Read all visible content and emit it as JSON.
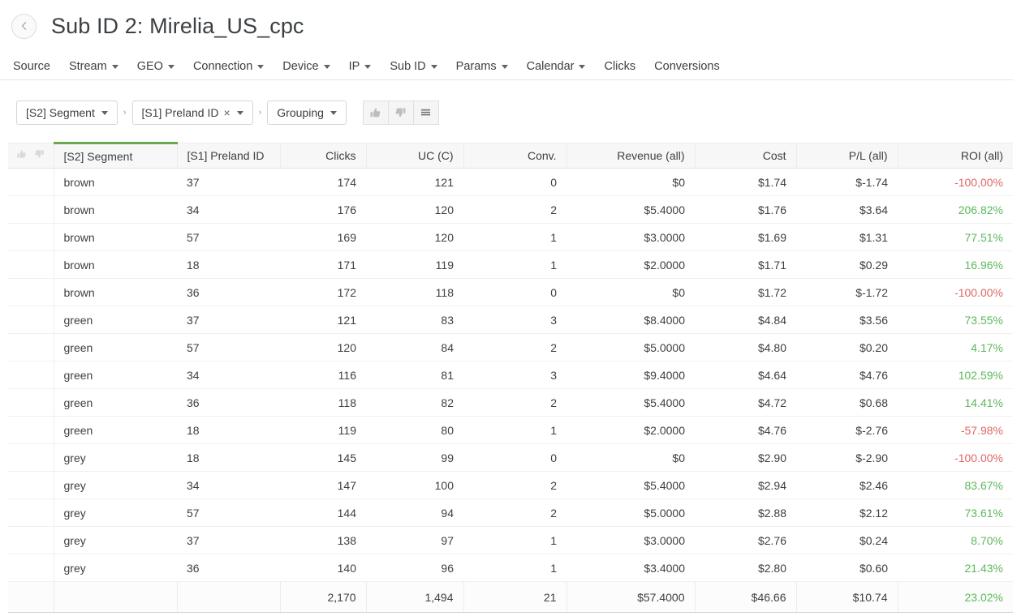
{
  "header": {
    "back_icon": "chevron-left-icon",
    "title": "Sub ID 2: Mirelia_US_cpc"
  },
  "nav": {
    "items": [
      {
        "label": "Source",
        "has_caret": false
      },
      {
        "label": "Stream",
        "has_caret": true
      },
      {
        "label": "GEO",
        "has_caret": true
      },
      {
        "label": "Connection",
        "has_caret": true
      },
      {
        "label": "Device",
        "has_caret": true
      },
      {
        "label": "IP",
        "has_caret": true
      },
      {
        "label": "Sub ID",
        "has_caret": true
      },
      {
        "label": "Params",
        "has_caret": true
      },
      {
        "label": "Calendar",
        "has_caret": true
      },
      {
        "label": "Clicks",
        "has_caret": false
      },
      {
        "label": "Conversions",
        "has_caret": false
      }
    ]
  },
  "toolbar": {
    "chips": [
      {
        "label": "[S2] Segment",
        "removable": false
      },
      {
        "label": "[S1] Preland ID",
        "removable": true
      },
      {
        "label": "Grouping",
        "removable": false
      }
    ],
    "separator": "›",
    "buttons": [
      {
        "icon": "thumbs-up-icon",
        "name": "vote-up-button"
      },
      {
        "icon": "thumbs-down-icon",
        "name": "vote-down-button"
      },
      {
        "icon": "hamburger-menu-icon",
        "name": "table-menu-button"
      }
    ]
  },
  "table": {
    "vote_icons": {
      "up": "thumbs-up-icon",
      "down": "thumbs-down-icon"
    },
    "sorted_column_index": 0,
    "sort_accent_color": "#6aa84f",
    "positive_color": "#5cb85c",
    "negative_color": "#e06666",
    "columns": [
      {
        "label": "[S2] Segment",
        "align": "left"
      },
      {
        "label": "[S1] Preland ID",
        "align": "left"
      },
      {
        "label": "Clicks",
        "align": "right"
      },
      {
        "label": "UC (C)",
        "align": "right"
      },
      {
        "label": "Conv.",
        "align": "right"
      },
      {
        "label": "Revenue (all)",
        "align": "right"
      },
      {
        "label": "Cost",
        "align": "right"
      },
      {
        "label": "P/L (all)",
        "align": "right"
      },
      {
        "label": "ROI (all)",
        "align": "right"
      }
    ],
    "rows": [
      {
        "segment": "brown",
        "preland_id": "37",
        "clicks": "174",
        "uc": "121",
        "conv": "0",
        "revenue": "$0",
        "cost": "$1.74",
        "pl": "$-1.74",
        "roi": "-100,00%",
        "roi_sign": "neg"
      },
      {
        "segment": "brown",
        "preland_id": "34",
        "clicks": "176",
        "uc": "120",
        "conv": "2",
        "revenue": "$5.4000",
        "cost": "$1.76",
        "pl": "$3.64",
        "roi": "206.82%",
        "roi_sign": "pos"
      },
      {
        "segment": "brown",
        "preland_id": "57",
        "clicks": "169",
        "uc": "120",
        "conv": "1",
        "revenue": "$3.0000",
        "cost": "$1.69",
        "pl": "$1.31",
        "roi": "77.51%",
        "roi_sign": "pos"
      },
      {
        "segment": "brown",
        "preland_id": "18",
        "clicks": "171",
        "uc": "119",
        "conv": "1",
        "revenue": "$2.0000",
        "cost": "$1.71",
        "pl": "$0.29",
        "roi": "16.96%",
        "roi_sign": "pos"
      },
      {
        "segment": "brown",
        "preland_id": "36",
        "clicks": "172",
        "uc": "118",
        "conv": "0",
        "revenue": "$0",
        "cost": "$1.72",
        "pl": "$-1.72",
        "roi": "-100.00%",
        "roi_sign": "neg"
      },
      {
        "segment": "green",
        "preland_id": "37",
        "clicks": "121",
        "uc": "83",
        "conv": "3",
        "revenue": "$8.4000",
        "cost": "$4.84",
        "pl": "$3.56",
        "roi": "73.55%",
        "roi_sign": "pos"
      },
      {
        "segment": "green",
        "preland_id": "57",
        "clicks": "120",
        "uc": "84",
        "conv": "2",
        "revenue": "$5.0000",
        "cost": "$4.80",
        "pl": "$0.20",
        "roi": "4.17%",
        "roi_sign": "pos"
      },
      {
        "segment": "green",
        "preland_id": "34",
        "clicks": "116",
        "uc": "81",
        "conv": "3",
        "revenue": "$9.4000",
        "cost": "$4.64",
        "pl": "$4.76",
        "roi": "102.59%",
        "roi_sign": "pos"
      },
      {
        "segment": "green",
        "preland_id": "36",
        "clicks": "118",
        "uc": "82",
        "conv": "2",
        "revenue": "$5.4000",
        "cost": "$4.72",
        "pl": "$0.68",
        "roi": "14.41%",
        "roi_sign": "pos"
      },
      {
        "segment": "green",
        "preland_id": "18",
        "clicks": "119",
        "uc": "80",
        "conv": "1",
        "revenue": "$2.0000",
        "cost": "$4.76",
        "pl": "$-2.76",
        "roi": "-57.98%",
        "roi_sign": "neg"
      },
      {
        "segment": "grey",
        "preland_id": "18",
        "clicks": "145",
        "uc": "99",
        "conv": "0",
        "revenue": "$0",
        "cost": "$2.90",
        "pl": "$-2.90",
        "roi": "-100.00%",
        "roi_sign": "neg"
      },
      {
        "segment": "grey",
        "preland_id": "34",
        "clicks": "147",
        "uc": "100",
        "conv": "2",
        "revenue": "$5.4000",
        "cost": "$2.94",
        "pl": "$2.46",
        "roi": "83.67%",
        "roi_sign": "pos"
      },
      {
        "segment": "grey",
        "preland_id": "57",
        "clicks": "144",
        "uc": "94",
        "conv": "2",
        "revenue": "$5.0000",
        "cost": "$2.88",
        "pl": "$2.12",
        "roi": "73.61%",
        "roi_sign": "pos"
      },
      {
        "segment": "grey",
        "preland_id": "37",
        "clicks": "138",
        "uc": "97",
        "conv": "1",
        "revenue": "$3.0000",
        "cost": "$2.76",
        "pl": "$0.24",
        "roi": "8.70%",
        "roi_sign": "pos"
      },
      {
        "segment": "grey",
        "preland_id": "36",
        "clicks": "140",
        "uc": "96",
        "conv": "1",
        "revenue": "$3.4000",
        "cost": "$2.80",
        "pl": "$0.60",
        "roi": "21.43%",
        "roi_sign": "pos"
      }
    ],
    "totals": {
      "segment": "",
      "preland_id": "",
      "clicks": "2,170",
      "uc": "1,494",
      "conv": "21",
      "revenue": "$57.4000",
      "cost": "$46.66",
      "pl": "$10.74",
      "roi": "23.02%",
      "roi_sign": "pos"
    }
  }
}
